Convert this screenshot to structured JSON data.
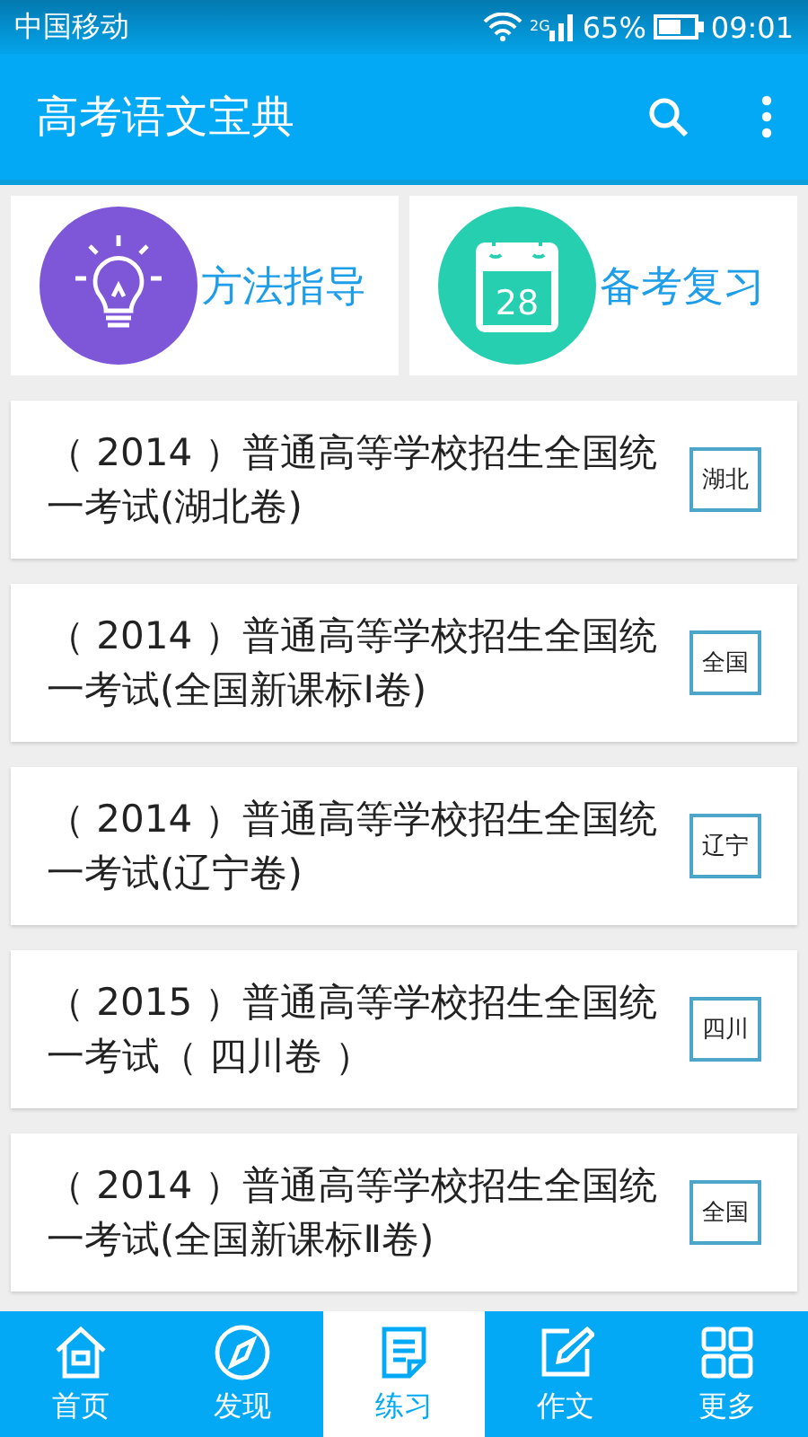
{
  "status_bar": {
    "carrier": "中国移动",
    "network": "2G",
    "battery": "65%",
    "time": "09:01"
  },
  "app_bar": {
    "title": "高考语文宝典"
  },
  "shortcuts": [
    {
      "kind": "bulb",
      "label": "方法指导",
      "color": "#7e57d8"
    },
    {
      "kind": "calendar",
      "label": "备考复习",
      "day": "28",
      "color": "#26cfb0"
    }
  ],
  "papers": [
    {
      "title": "（ 2014 ）普通高等学校招生全国统一考试(湖北卷)",
      "tag": "湖北"
    },
    {
      "title": "（ 2014 ）普通高等学校招生全国统一考试(全国新课标Ⅰ卷)",
      "tag": "全国"
    },
    {
      "title": "（ 2014 ）普通高等学校招生全国统一考试(辽宁卷)",
      "tag": "辽宁"
    },
    {
      "title": "（ 2015 ）普通高等学校招生全国统一考试（ 四川卷 ）",
      "tag": "四川"
    },
    {
      "title": "（ 2014 ）普通高等学校招生全国统一考试(全国新课标Ⅱ卷)",
      "tag": "全国"
    }
  ],
  "tabs": [
    {
      "kind": "home",
      "label": "首页",
      "selected": false
    },
    {
      "kind": "compass",
      "label": "发现",
      "selected": false
    },
    {
      "kind": "note",
      "label": "练习",
      "selected": true
    },
    {
      "kind": "edit",
      "label": "作文",
      "selected": false
    },
    {
      "kind": "grid",
      "label": "更多",
      "selected": false
    }
  ]
}
